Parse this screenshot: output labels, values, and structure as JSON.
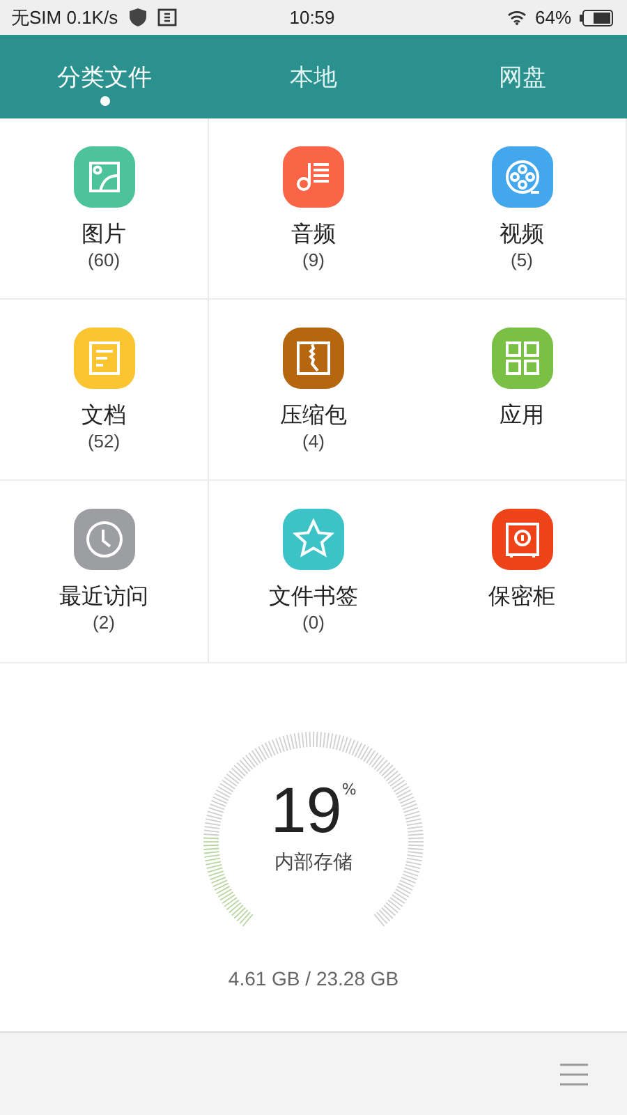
{
  "status_bar": {
    "carrier": "无SIM 0.1K/s",
    "time": "10:59",
    "battery": "64%"
  },
  "tabs": [
    {
      "label": "分类文件",
      "selected": true
    },
    {
      "label": "本地",
      "selected": false
    },
    {
      "label": "网盘",
      "selected": false
    }
  ],
  "categories": [
    {
      "kind": "image",
      "label": "图片",
      "count": "(60)",
      "color": "#4dc39b"
    },
    {
      "kind": "music",
      "label": "音频",
      "count": "(9)",
      "color": "#fa6548"
    },
    {
      "kind": "video",
      "label": "视频",
      "count": "(5)",
      "color": "#43a7ee"
    },
    {
      "kind": "document",
      "label": "文档",
      "count": "(52)",
      "color": "#fbc531"
    },
    {
      "kind": "archive",
      "label": "压缩包",
      "count": "(4)",
      "color": "#b5660f"
    },
    {
      "kind": "apps",
      "label": "应用",
      "color": "#79c045"
    },
    {
      "kind": "recent",
      "label": "最近访问",
      "count": "(2)",
      "color": "#9c9ea2"
    },
    {
      "kind": "bookmark",
      "label": "文件书签",
      "count": "(0)",
      "color": "#3cc3c8"
    },
    {
      "kind": "safe",
      "label": "保密柜",
      "color": "#ee4219"
    }
  ],
  "storage": {
    "percent": "19",
    "unit": "%",
    "label": "内部存储",
    "usage": "4.61 GB / 23.28 GB",
    "level": 0.19
  }
}
